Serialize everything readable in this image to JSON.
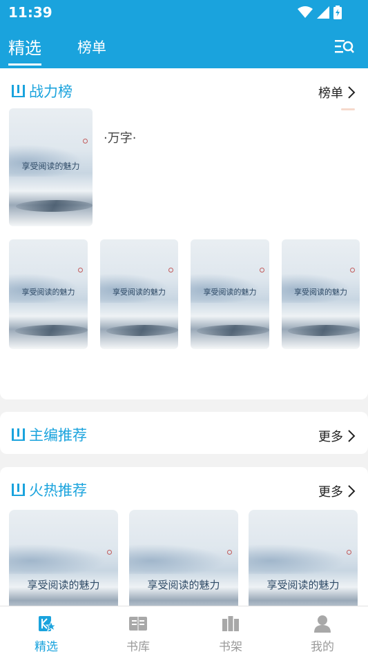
{
  "status_bar": {
    "time": "11:39"
  },
  "header": {
    "tabs": [
      {
        "label": "精选"
      },
      {
        "label": "榜单"
      }
    ]
  },
  "section_power": {
    "title": "战力榜",
    "more_label": "榜单",
    "featured_book": {
      "cover_text": "享受阅读的魅力",
      "desc": "·万字·"
    },
    "books": [
      {
        "cover_text": "享受阅读的魅力"
      },
      {
        "cover_text": "享受阅读的魅力"
      },
      {
        "cover_text": "享受阅读的魅力"
      },
      {
        "cover_text": "享受阅读的魅力"
      }
    ]
  },
  "section_editor": {
    "title": "主编推荐",
    "more_label": "更多"
  },
  "section_hot": {
    "title": "火热推荐",
    "more_label": "更多",
    "books": [
      {
        "cover_text": "享受阅读的魅力"
      },
      {
        "cover_text": "享受阅读的魅力"
      },
      {
        "cover_text": "享受阅读的魅力"
      }
    ]
  },
  "bottom_nav": {
    "items": [
      {
        "label": "精选",
        "icon": "featured-icon",
        "active": true
      },
      {
        "label": "书库",
        "icon": "library-icon",
        "active": false
      },
      {
        "label": "书架",
        "icon": "bookshelf-icon",
        "active": false
      },
      {
        "label": "我的",
        "icon": "profile-icon",
        "active": false
      }
    ]
  },
  "colors": {
    "accent": "#1aa3dd",
    "background": "#f2f2f2"
  }
}
